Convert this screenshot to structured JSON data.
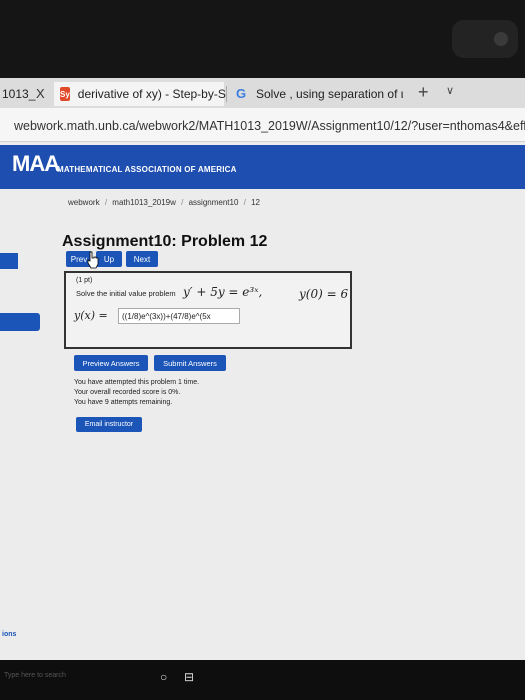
{
  "browser": {
    "tabs": [
      {
        "label": "1013_",
        "close": "X"
      },
      {
        "label": "derivative of xy) - Step-by-S",
        "favicon": "Sy"
      },
      {
        "label": "Solve , using separation of ι",
        "favicon": "G"
      }
    ],
    "new_tab": "+",
    "tab_menu": "∨",
    "url": "webwork.math.unb.ca/webwork2/MATH1013_2019W/Assignment10/12/?user=nthomas4&effectiveUs"
  },
  "header": {
    "logo": "MAA",
    "subtitle": "MATHEMATICAL ASSOCIATION OF AMERICA"
  },
  "breadcrumb": [
    "webwork",
    "math1013_2019w",
    "assignment10",
    "12"
  ],
  "breadcrumb_sep": "/",
  "page_title": "Assignment10: Problem 12",
  "nav": {
    "prev": "Prev",
    "up": "Up",
    "next": "Next"
  },
  "problem": {
    "points": "(1 pt)",
    "statement": "Solve the initial value problem",
    "equation": "y′ + 5y = e³ˣ,",
    "initial_condition": "y(0) = 6",
    "answer_label": "y(x) =",
    "answer_value": "((1/8)e^(3x))+(47/8)e^(5x"
  },
  "actions": {
    "preview": "Preview Answers",
    "submit": "Submit Answers"
  },
  "attempts": {
    "line1": "You have attempted this problem 1 time.",
    "line2": "Your overall recorded score is 0%.",
    "line3": "You have 9 attempts remaining."
  },
  "email_instructor": "Email instructor",
  "side_label": "ions",
  "taskbar": {
    "search_hint": "Type here to search"
  },
  "colors": {
    "maa_blue": "#1e4fb0",
    "button_blue": "#1c55b8"
  }
}
